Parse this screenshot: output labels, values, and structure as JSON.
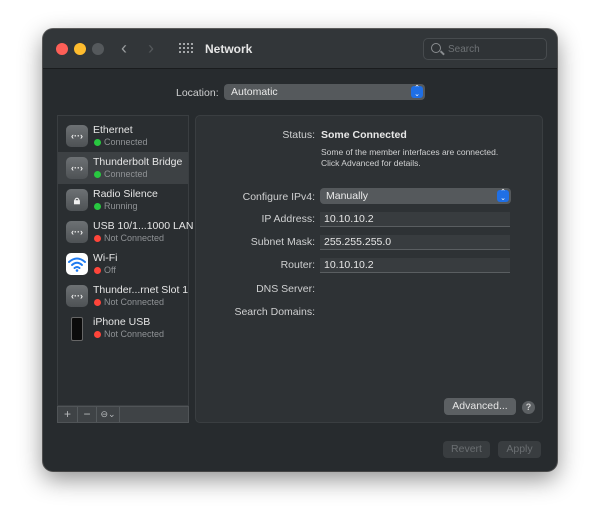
{
  "window": {
    "title": "Network",
    "search_placeholder": "Search",
    "traffic_colors": {
      "close": "#fe5f57",
      "minimize": "#febc2e",
      "maximize": "#55595c"
    }
  },
  "location": {
    "label": "Location:",
    "value": "Automatic"
  },
  "services": [
    {
      "name": "Ethernet",
      "status": "Connected",
      "status_color": "green",
      "icon": "ethernet-icon",
      "selected": false
    },
    {
      "name": "Thunderbolt Bridge",
      "status": "Connected",
      "status_color": "green",
      "icon": "ethernet-icon",
      "selected": true
    },
    {
      "name": "Radio Silence",
      "status": "Running",
      "status_color": "green",
      "icon": "lock-icon",
      "selected": false
    },
    {
      "name": "USB 10/1...1000 LAN",
      "status": "Not Connected",
      "status_color": "red",
      "icon": "ethernet-icon",
      "selected": false
    },
    {
      "name": "Wi-Fi",
      "status": "Off",
      "status_color": "red",
      "icon": "wifi-icon",
      "selected": false
    },
    {
      "name": "Thunder...rnet Slot 1",
      "status": "Not Connected",
      "status_color": "red",
      "icon": "ethernet-icon",
      "selected": false
    },
    {
      "name": "iPhone USB",
      "status": "Not Connected",
      "status_color": "red",
      "icon": "iphone-icon",
      "selected": false
    }
  ],
  "sidebar_toolbar": {
    "add": "+",
    "remove": "−",
    "action": "⊖⌄"
  },
  "detail": {
    "status_label": "Status:",
    "status_value": "Some Connected",
    "status_desc_1": "Some of the member interfaces are connected.",
    "status_desc_2": "Click Advanced for details.",
    "configure_label": "Configure IPv4:",
    "configure_value": "Manually",
    "ip_label": "IP Address:",
    "ip_value": "10.10.10.2",
    "subnet_label": "Subnet Mask:",
    "subnet_value": "255.255.255.0",
    "router_label": "Router:",
    "router_value": "10.10.10.2",
    "dns_label": "DNS Server:",
    "search_domains_label": "Search Domains:",
    "advanced_button": "Advanced...",
    "help_button": "?"
  },
  "footer": {
    "revert": "Revert",
    "apply": "Apply"
  },
  "colors": {
    "accent": "#1f6fe5",
    "connected": "#28c840",
    "not_connected": "#ff453a"
  }
}
